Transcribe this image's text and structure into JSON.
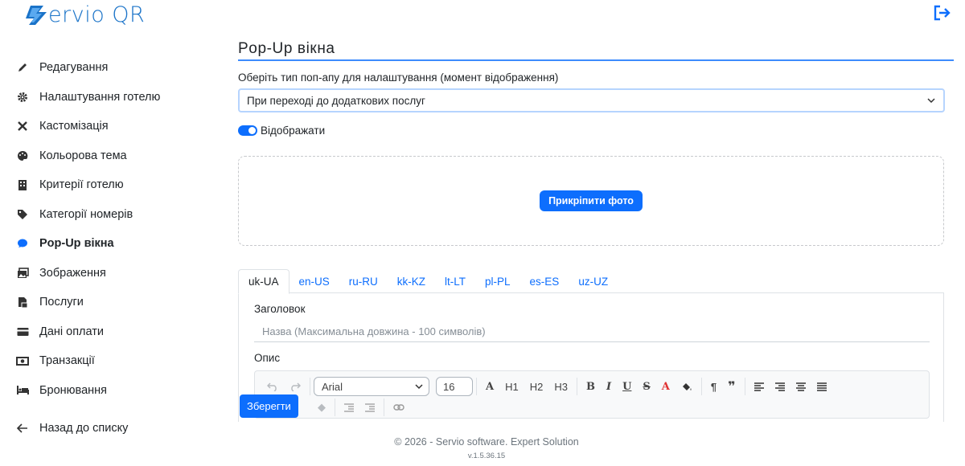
{
  "brand": {
    "logo_text": "ervio QR",
    "accent": "#0d6efd"
  },
  "sidebar": {
    "items": [
      {
        "label": "Редагування",
        "icon": "pencil-icon"
      },
      {
        "label": "Налаштування готелю",
        "icon": "gear-icon"
      },
      {
        "label": "Кастомізація",
        "icon": "tools-icon"
      },
      {
        "label": "Кольорова тема",
        "icon": "palette-icon"
      },
      {
        "label": "Критерії готелю",
        "icon": "building-icon"
      },
      {
        "label": "Категорії номерів",
        "icon": "tag-icon"
      },
      {
        "label": "Pop-Up вікна",
        "icon": "chat-icon",
        "active": true
      },
      {
        "label": "Зображення",
        "icon": "images-icon"
      },
      {
        "label": "Послуги",
        "icon": "file-icon"
      },
      {
        "label": "Дані оплати",
        "icon": "card-icon"
      },
      {
        "label": "Транзакції",
        "icon": "money-icon"
      },
      {
        "label": "Бронювання",
        "icon": "bed-icon"
      }
    ],
    "back_label": "Назад до списку"
  },
  "main": {
    "title": "Pop-Up вікна",
    "popup_type_label": "Оберіть тип поп-апу для налаштування (момент відображення)",
    "popup_type_value": "При переході до додаткових послуг",
    "display_toggle_label": "Відображати",
    "display_toggle_on": true,
    "attach_photo_label": "Прикріпити фото",
    "tabs": [
      "uk-UA",
      "en-US",
      "ru-RU",
      "kk-KZ",
      "lt-LT",
      "pl-PL",
      "es-ES",
      "uz-UZ"
    ],
    "active_tab": "uk-UA",
    "heading_label": "Заголовок",
    "heading_placeholder": "Назва (Максимальна довжина - 100 символів)",
    "description_label": "Опис",
    "editor": {
      "font": "Arial",
      "font_size": "16",
      "h1": "H1",
      "h2": "H2",
      "h3": "H3",
      "bold": "B",
      "italic": "I",
      "underline": "U",
      "strike": "S",
      "font_color_letter": "A",
      "font_size_letter": "A"
    },
    "save_label": "Зберегти"
  },
  "footer": {
    "copyright": "© 2026 - Servio software. Expert Solution",
    "version": "v.1.5.36.15"
  }
}
